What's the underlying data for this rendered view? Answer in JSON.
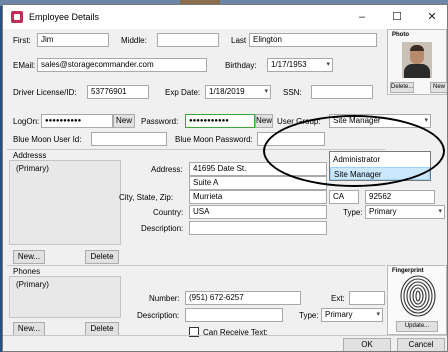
{
  "window": {
    "title": "Employee Details"
  },
  "name": {
    "first_label": "First:",
    "first_value": "Jim",
    "middle_label": "Middle:",
    "middle_value": "",
    "last_label": "Last",
    "last_value": "Elington"
  },
  "contact": {
    "email_label": "EMail:",
    "email_value": "sales@storagecommander.com",
    "birthday_label": "Birthday:",
    "birthday_value": "1/17/1953"
  },
  "license": {
    "label": "Driver License/ID:",
    "value": "53776901",
    "exp_label": "Exp Date:",
    "exp_value": "1/18/2019",
    "ssn_label": "SSN:",
    "ssn_value": ""
  },
  "logon": {
    "label": "LogOn:",
    "value": "●●●●●●●●●●",
    "new_label": "New",
    "password_label": "Password:",
    "password_value": "●●●●●●●●●●●",
    "password_new_label": "New",
    "user_group_label": "User Group:",
    "user_group_value": "Site Manager",
    "user_group_options": [
      "Administrator",
      "Site Manager"
    ]
  },
  "bluemoon": {
    "user_id_label": "Blue Moon User Id:",
    "user_id_value": "",
    "password_label": "Blue Moon Password:"
  },
  "address": {
    "section_label": "Addresss",
    "list_item": "(Primary)",
    "new_label": "New...",
    "delete_label": "Delete",
    "address_label": "Address:",
    "line1": "41695 Date St.",
    "line2": "Suite A",
    "csz_label": "City, State, Zip:",
    "city": "Murrieta",
    "state": "CA",
    "zip": "92562",
    "country_label": "Country:",
    "country": "USA",
    "type_label": "Type:",
    "type": "Primary",
    "description_label": "Description:",
    "description": ""
  },
  "phones": {
    "section_label": "Phones",
    "list_item": "(Primary)",
    "new_label": "New...",
    "delete_label": "Delete",
    "number_label": "Number:",
    "number": "(951) 672-6257",
    "ext_label": "Ext:",
    "ext": "",
    "description_label": "Description:",
    "description": "",
    "type_label": "Type:",
    "type": "Primary",
    "receive_text_label": "Can Receive Text:"
  },
  "photo": {
    "label": "Photo",
    "delete_label": "Delete...",
    "new_label": "New"
  },
  "fingerprint": {
    "label": "Fingerprint",
    "update_label": "Update..."
  },
  "footer": {
    "ok_label": "OK",
    "cancel_label": "Cancel"
  },
  "window_buttons": {
    "minimize": "–",
    "maximize": "☐",
    "close": "✕"
  }
}
